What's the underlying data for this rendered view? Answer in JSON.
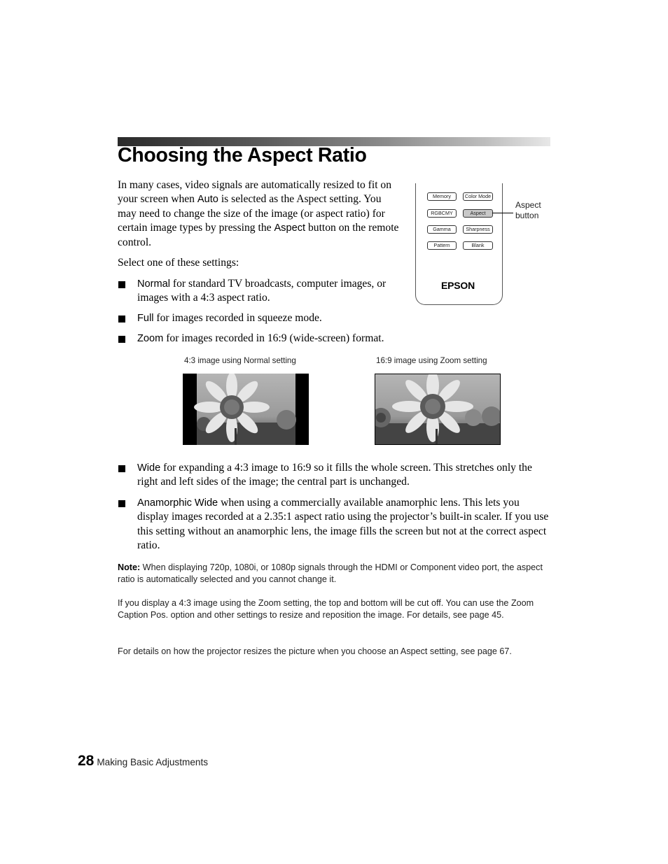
{
  "page": {
    "title": "Choosing the Aspect Ratio",
    "intro": {
      "part1": "In many cases, video signals are automatically resized to fit on your screen when ",
      "kw1": "Auto",
      "part2": " is selected as the Aspect setting. You may need to change the size of the image (or aspect ratio) for certain image types by pressing the ",
      "kw2": "Aspect",
      "part3": " button on the remote control."
    },
    "select_prompt": "Select one of these settings:",
    "settings": [
      {
        "name": "Normal",
        "desc": " for standard TV broadcasts, computer images, or images with a 4:3 aspect ratio."
      },
      {
        "name": "Full",
        "desc": " for images recorded in squeeze mode."
      },
      {
        "name": "Zoom",
        "desc": " for images recorded in 16:9 (wide-screen) format."
      },
      {
        "name": "Wide",
        "desc": " for expanding a 4:3 image to 16:9 so it fills the whole screen. This stretches only the right and left sides of the image; the central part is unchanged."
      },
      {
        "name": "Anamorphic Wide",
        "desc": " when using a commercially available anamorphic lens. This lets you display images recorded at a 2.35:1 aspect ratio using the projector’s built-in scaler. If you use this setting without an anamorphic lens, the image fills the screen but not at the correct aspect ratio."
      }
    ],
    "remote": {
      "buttons": [
        "Memory",
        "Color Mode",
        "RGBCMY",
        "Aspect",
        "Gamma",
        "Sharpness",
        "Pattern",
        "Blank"
      ],
      "highlighted": "Aspect",
      "brand": "EPSON",
      "callout": [
        "Aspect",
        "button"
      ]
    },
    "figures": [
      {
        "caption": "4:3 image using Normal setting",
        "icon": "sunflower-photo"
      },
      {
        "caption": "16:9 image using Zoom setting",
        "icon": "sunflower-photo"
      }
    ],
    "notes": {
      "label": "Note:",
      "note1": " When displaying 720p, 1080i, or 1080p signals through the HDMI or Component video port, the aspect ratio is automatically selected and you cannot change it.",
      "note2": "If you display a 4:3 image using the Zoom setting, the top and bottom will be cut off. You can use the Zoom Caption Pos. option and other settings to resize and reposition the image. For details, see page 45.",
      "note3": "For details on how the projector resizes the picture when you choose an Aspect setting, see page 67."
    },
    "footer": {
      "page_number": "28",
      "chapter": "Making Basic Adjustments"
    }
  }
}
